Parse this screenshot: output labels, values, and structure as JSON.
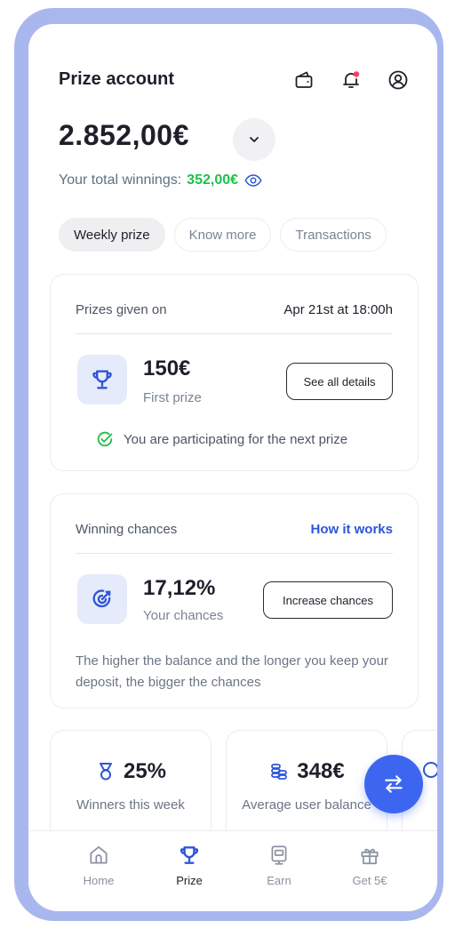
{
  "header": {
    "title": "Prize account"
  },
  "balance": {
    "amount": "2.852,00€"
  },
  "winnings": {
    "label": "Your total winnings:",
    "amount": "352,00€"
  },
  "tabs": [
    {
      "label": "Weekly prize",
      "active": true
    },
    {
      "label": "Know more",
      "active": false
    },
    {
      "label": "Transactions",
      "active": false
    }
  ],
  "prize_card": {
    "label": "Prizes given on",
    "date": "Apr 21st at 18:00h",
    "value": "150€",
    "value_label": "First prize",
    "button": "See all details",
    "participation": "You are participating for the next prize"
  },
  "chances_card": {
    "label": "Winning chances",
    "link": "How it works",
    "value": "17,12%",
    "value_label": "Your chances",
    "button": "Increase chances",
    "description": "The higher the balance and the longer you keep your deposit, the bigger the chances"
  },
  "stats": [
    {
      "value": "25%",
      "label": "Winners this week",
      "icon": "medal-icon"
    },
    {
      "value": "348€",
      "label": "Average user balance",
      "icon": "coins-icon"
    }
  ],
  "nav": [
    {
      "label": "Home",
      "icon": "home-icon",
      "active": false
    },
    {
      "label": "Prize",
      "icon": "trophy-icon",
      "active": true
    },
    {
      "label": "Earn",
      "icon": "earn-icon",
      "active": false
    },
    {
      "label": "Get 5€",
      "icon": "gift-icon",
      "active": false
    }
  ],
  "colors": {
    "accent": "#3d66f0",
    "link": "#2e55d9",
    "success": "#1fbf4a",
    "frame": "#a9b7ef",
    "notification": "#ff3b5c"
  }
}
